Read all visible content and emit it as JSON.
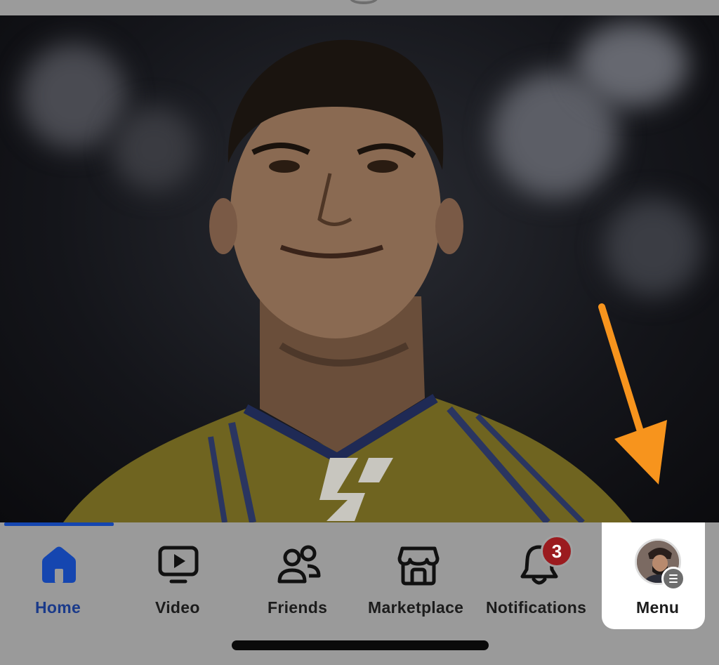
{
  "tabbar": {
    "tabs": [
      {
        "label": "Home",
        "icon": "home-icon",
        "active": true
      },
      {
        "label": "Video",
        "icon": "video-icon",
        "active": false
      },
      {
        "label": "Friends",
        "icon": "friends-icon",
        "active": false
      },
      {
        "label": "Marketplace",
        "icon": "marketplace-icon",
        "active": false
      },
      {
        "label": "Notifications",
        "icon": "bell-icon",
        "active": false
      },
      {
        "label": "Menu",
        "icon": "avatar",
        "active": false
      }
    ],
    "notifications_badge": "3"
  },
  "colors": {
    "active_tab": "#1546b0",
    "tabbar_bg": "#9a9a9a",
    "badge_red": "#9b1b1f",
    "annotation_arrow": "#f7941d"
  }
}
